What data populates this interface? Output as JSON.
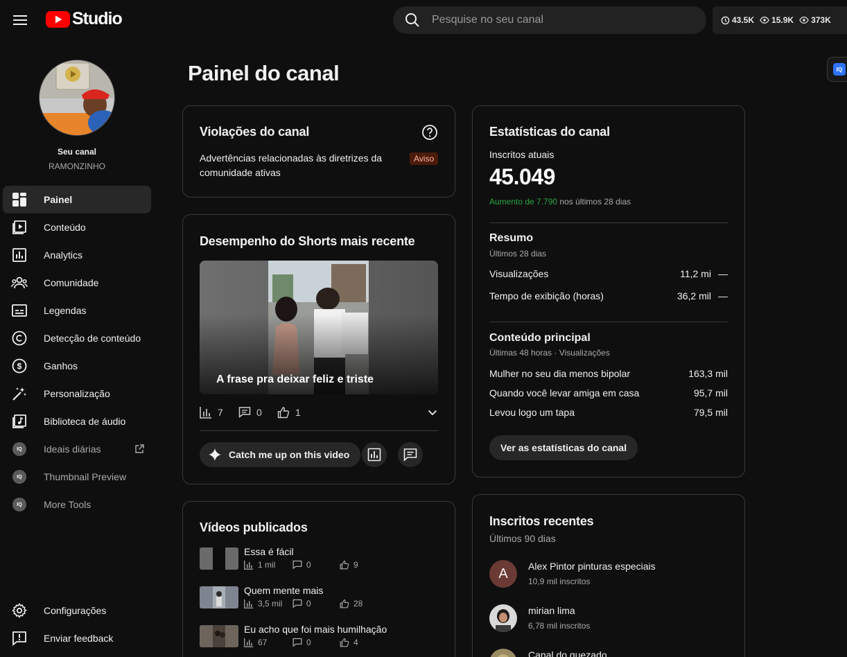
{
  "header": {
    "logo_text": "Studio",
    "search_placeholder": "Pesquise no seu canal",
    "stats": {
      "watch_hours": "43.5K",
      "views_a": "15.9K",
      "views_b": "373K"
    },
    "extension_badge": "IQ"
  },
  "sidebar": {
    "your_channel": "Seu canal",
    "channel_name": "RAMONZINHO",
    "items": [
      {
        "label": "Painel",
        "icon": "dashboard-icon",
        "active": true
      },
      {
        "label": "Conteúdo",
        "icon": "content-icon"
      },
      {
        "label": "Analytics",
        "icon": "analytics-icon"
      },
      {
        "label": "Comunidade",
        "icon": "community-icon"
      },
      {
        "label": "Legendas",
        "icon": "subtitles-icon"
      },
      {
        "label": "Detecção de conteúdo",
        "icon": "copyright-icon"
      },
      {
        "label": "Ganhos",
        "icon": "earn-icon"
      },
      {
        "label": "Personalização",
        "icon": "customization-icon"
      },
      {
        "label": "Biblioteca de áudio",
        "icon": "audio-library-icon"
      },
      {
        "label": "Ideais diárias",
        "icon": "iq-icon"
      },
      {
        "label": "Thumbnail Preview",
        "icon": "iq-icon"
      },
      {
        "label": "More Tools",
        "icon": "iq-icon"
      }
    ],
    "bottom": [
      {
        "label": "Configurações",
        "icon": "settings-icon"
      },
      {
        "label": "Enviar feedback",
        "icon": "feedback-icon"
      }
    ]
  },
  "main": {
    "title": "Painel do canal",
    "violations": {
      "title": "Violações do canal",
      "text": "Advertências relacionadas às diretrizes da comunidade ativas",
      "badge": "Aviso"
    },
    "shorts": {
      "title": "Desempenho do Shorts mais recente",
      "caption": "A frase pra deixar feliz e triste",
      "views": "7",
      "comments": "0",
      "likes": "1",
      "catch_up": "Catch me up on this video"
    },
    "published": {
      "title": "Vídeos publicados",
      "videos": [
        {
          "title": "Essa é fácil",
          "views": "1 mil",
          "comments": "0",
          "likes": "9"
        },
        {
          "title": "Quem mente mais",
          "views": "3,5 mil",
          "comments": "0",
          "likes": "28"
        },
        {
          "title": "Eu acho que foi mais humilhação",
          "views": "67",
          "comments": "0",
          "likes": "4"
        }
      ]
    },
    "channel_stats": {
      "title": "Estatísticas do canal",
      "subs_label": "Inscritos atuais",
      "subs_value": "45.049",
      "increase_prefix": "Aumento de 7.790",
      "increase_suffix": " nos últimos 28 dias",
      "summary_title": "Resumo",
      "summary_period": "Últimos 28 dias",
      "summary_rows": [
        {
          "label": "Visualizações",
          "value": "11,2 mi",
          "trend": "—"
        },
        {
          "label": "Tempo de exibição (horas)",
          "value": "36,2 mil",
          "trend": "—"
        }
      ],
      "top_title": "Conteúdo principal",
      "top_period": "Últimas 48 horas · Visualizações",
      "top_rows": [
        {
          "label": "Mulher no seu dia menos bipolar",
          "value": "163,3 mil"
        },
        {
          "label": "Quando você levar amiga em casa",
          "value": "95,7 mil"
        },
        {
          "label": "Levou logo um tapa",
          "value": "79,5 mil"
        }
      ],
      "button": "Ver as estatísticas do canal"
    },
    "recent_subs": {
      "title": "Inscritos recentes",
      "period": "Últimos 90 dias",
      "subs": [
        {
          "name": "Alex Pintor pinturas especiais",
          "count": "10,9 mil inscritos",
          "initial": "A"
        },
        {
          "name": "mirian lima",
          "count": "6,78 mil inscritos"
        },
        {
          "name": "Canal do quezado",
          "count": ""
        }
      ]
    }
  },
  "colors": {
    "brand_red": "#ff0000",
    "increase_green": "#2ba640",
    "warning_bg": "#4a1b0b"
  }
}
